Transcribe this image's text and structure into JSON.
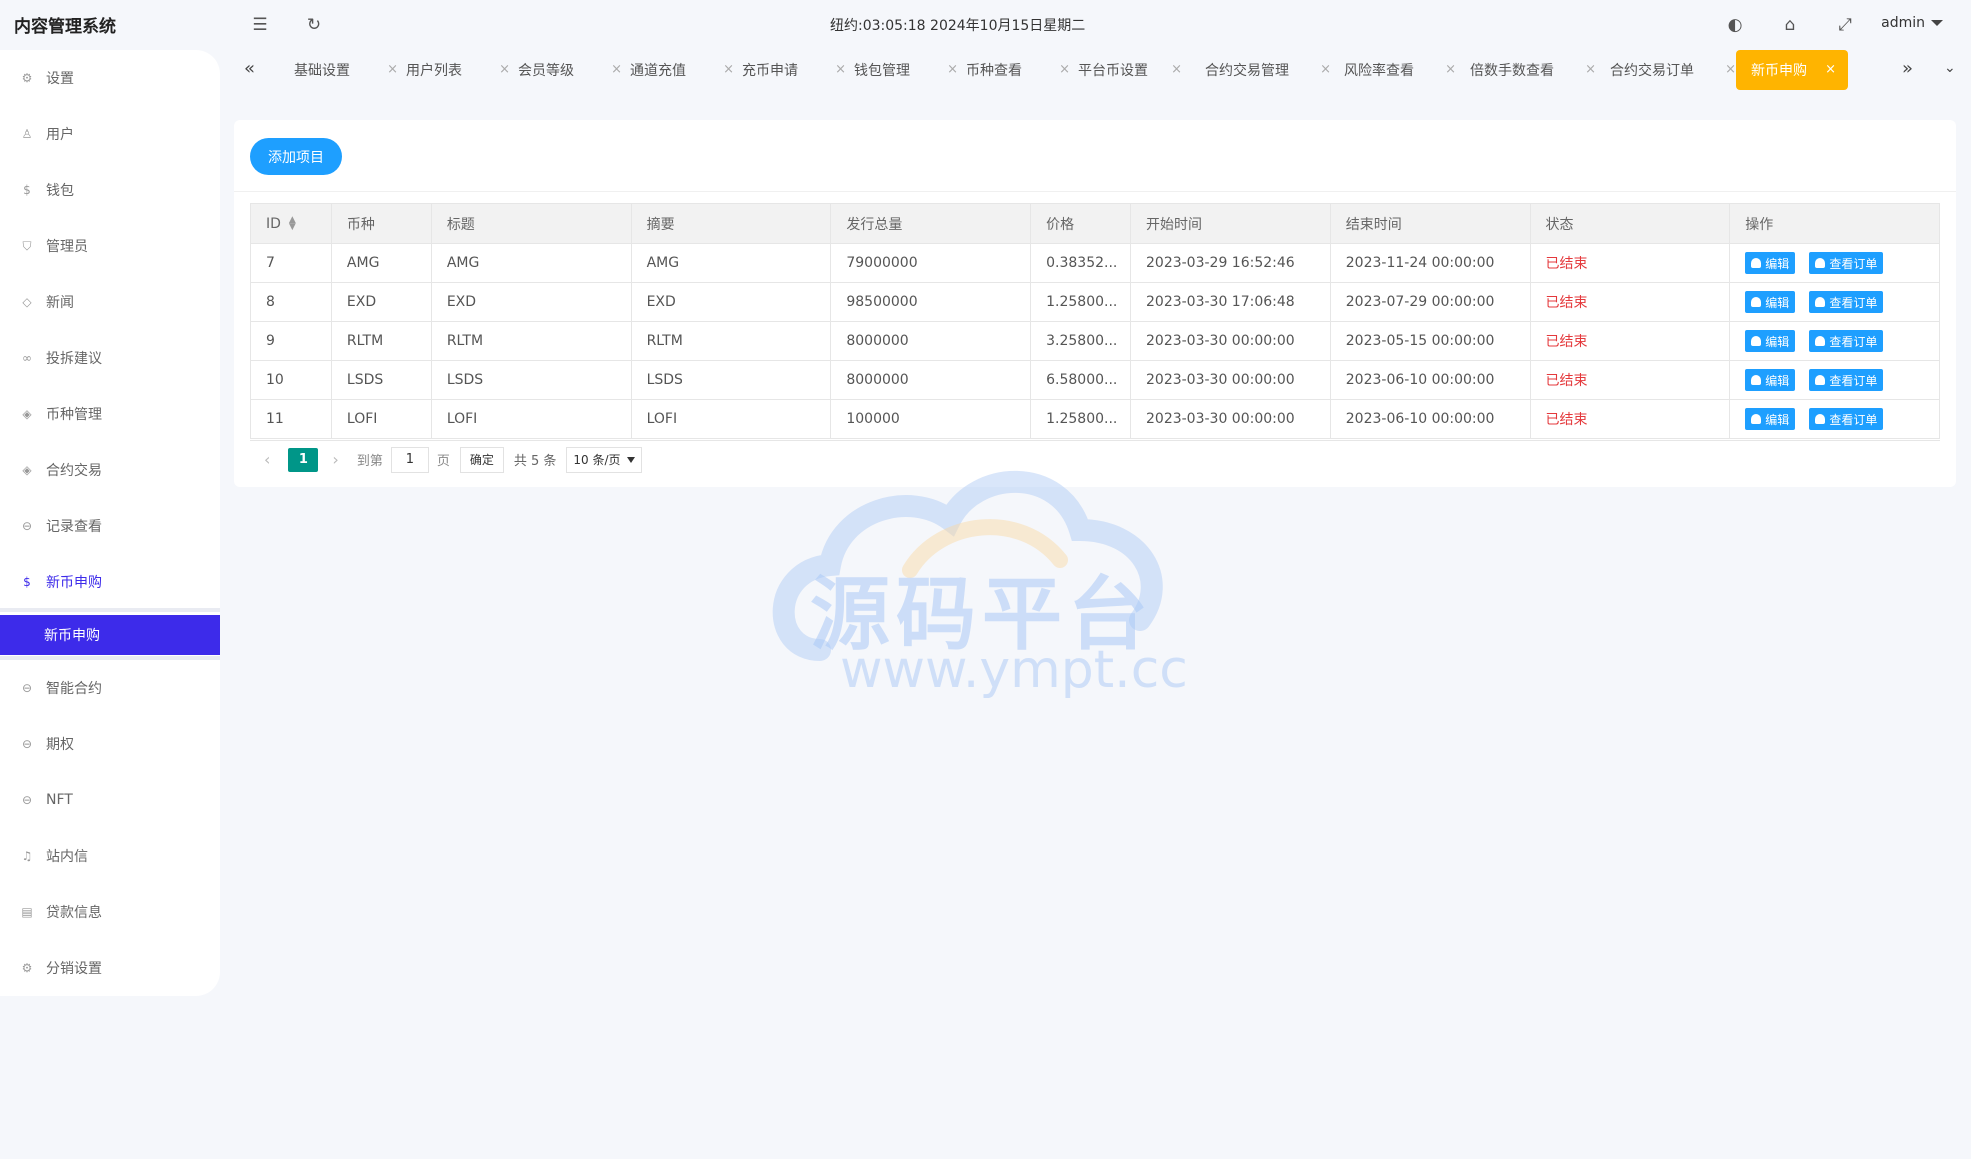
{
  "app": {
    "title": "内容管理系统"
  },
  "header": {
    "clock": "纽约:03:05:18 2024年10月15日星期二",
    "user": "admin"
  },
  "sidebar": {
    "items": [
      {
        "label": "设置",
        "icon": "gear-icon"
      },
      {
        "label": "用户",
        "icon": "user-icon"
      },
      {
        "label": "钱包",
        "icon": "dollar-icon"
      },
      {
        "label": "管理员",
        "icon": "shield-icon"
      },
      {
        "label": "新闻",
        "icon": "tag-icon"
      },
      {
        "label": "投拆建议",
        "icon": "link-icon"
      },
      {
        "label": "币种管理",
        "icon": "diamond-icon"
      },
      {
        "label": "合约交易",
        "icon": "diamond-icon"
      },
      {
        "label": "记录查看",
        "icon": "circle-arrow-icon"
      },
      {
        "label": "新币申购",
        "icon": "dollar-icon"
      },
      {
        "label": "智能合约",
        "icon": "circle-arrow-icon"
      },
      {
        "label": "期权",
        "icon": "circle-arrow-icon"
      },
      {
        "label": "NFT",
        "icon": "circle-arrow-icon"
      },
      {
        "label": "站内信",
        "icon": "bell-icon"
      },
      {
        "label": "贷款信息",
        "icon": "doc-icon"
      },
      {
        "label": "分销设置",
        "icon": "gear-icon"
      }
    ],
    "sub_active": "新币申购"
  },
  "tabs": [
    "基础设置",
    "用户列表",
    "会员等级",
    "通道充值",
    "充币申请",
    "钱包管理",
    "币种查看",
    "平台币设置",
    "合约交易管理",
    "风险率查看",
    "倍数手数查看",
    "合约交易订单",
    "新币申购"
  ],
  "toolbar": {
    "add_label": "添加项目"
  },
  "table": {
    "headers": [
      "ID",
      "币种",
      "标题",
      "摘要",
      "发行总量",
      "价格",
      "开始时间",
      "结束时间",
      "状态",
      "操作"
    ],
    "rows": [
      {
        "id": "7",
        "coin": "AMG",
        "title": "AMG",
        "summary": "AMG",
        "total": "79000000",
        "price": "0.38352...",
        "start": "2023-03-29 16:52:46",
        "end": "2023-11-24 00:00:00",
        "status": "已结束"
      },
      {
        "id": "8",
        "coin": "EXD",
        "title": "EXD",
        "summary": "EXD",
        "total": "98500000",
        "price": "1.25800...",
        "start": "2023-03-30 17:06:48",
        "end": "2023-07-29 00:00:00",
        "status": "已结束"
      },
      {
        "id": "9",
        "coin": "RLTM",
        "title": "RLTM",
        "summary": "RLTM",
        "total": "8000000",
        "price": "3.25800...",
        "start": "2023-03-30 00:00:00",
        "end": "2023-05-15 00:00:00",
        "status": "已结束"
      },
      {
        "id": "10",
        "coin": "LSDS",
        "title": "LSDS",
        "summary": "LSDS",
        "total": "8000000",
        "price": "6.58000...",
        "start": "2023-03-30 00:00:00",
        "end": "2023-06-10 00:00:00",
        "status": "已结束"
      },
      {
        "id": "11",
        "coin": "LOFI",
        "title": "LOFI",
        "summary": "LOFI",
        "total": "100000",
        "price": "1.25800...",
        "start": "2023-03-30 00:00:00",
        "end": "2023-06-10 00:00:00",
        "status": "已结束"
      }
    ],
    "edit_label": "编辑",
    "orders_label": "查看订单"
  },
  "pager": {
    "current": "1",
    "goto_label": "到第",
    "page_value": "1",
    "page_unit": "页",
    "confirm": "确定",
    "total": "共 5 条",
    "page_size": "10 条/页"
  },
  "watermark": {
    "text": "源码平台",
    "url": "www.ympt.cc"
  },
  "colors": {
    "accent": "#3d2bea",
    "active_tab": "#ffb400",
    "button": "#1e9fff",
    "pager": "#009688",
    "ended": "#e4393c"
  }
}
